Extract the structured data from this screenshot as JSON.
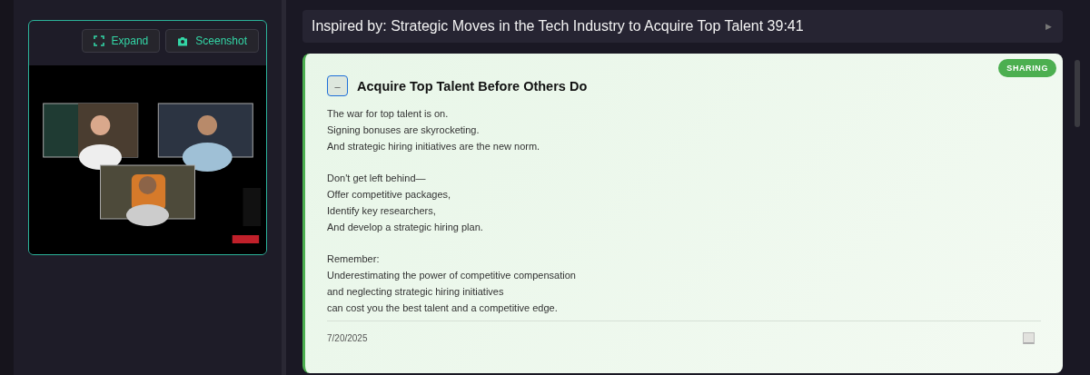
{
  "video_panel": {
    "buttons": [
      {
        "kind": "expand",
        "label": "Expand"
      },
      {
        "kind": "camera",
        "label": "Sceenshot"
      }
    ]
  },
  "header": {
    "title": "Inspired by: Strategic Moves in the Tech Industry to Acquire Top Talent 39:41",
    "play": "▶"
  },
  "card": {
    "badge": "SHARING",
    "toggle": "–",
    "expanded": true,
    "title": "Acquire Top Talent Before Others Do",
    "paragraphs": [
      [
        "The war for top talent is on.",
        "Signing bonuses are skyrocketing.",
        "And strategic hiring initiatives are the new norm."
      ],
      [
        "Don't get left behind—",
        "Offer competitive packages,",
        "Identify key researchers,",
        "And develop a strategic hiring plan."
      ],
      [
        "Remember:",
        "Underestimating the power of competitive compensation",
        "and neglecting strategic hiring initiatives",
        "can cost you the best talent and a competitive edge."
      ]
    ],
    "date": "7/20/2025"
  }
}
